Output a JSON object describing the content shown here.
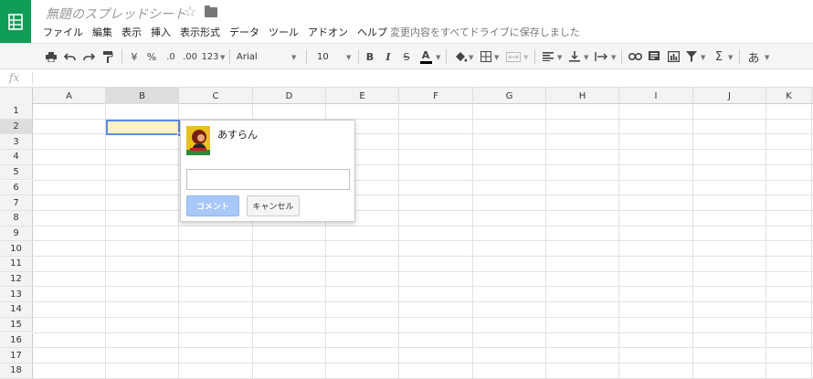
{
  "header": {
    "title": "無題のスプレッドシート",
    "save_status": "変更内容をすべてドライブに保存しました",
    "icons": [
      "sheets-logo-icon",
      "star-icon",
      "folder-icon"
    ]
  },
  "menu": [
    "ファイル",
    "編集",
    "表示",
    "挿入",
    "表示形式",
    "データ",
    "ツール",
    "アドオン",
    "ヘルプ"
  ],
  "toolbar": {
    "currency": "¥",
    "percent": "%",
    "decimal_decrease": ".0",
    "decimal_increase": ".00",
    "more_formats": "123",
    "font": "Arial",
    "font_size": "10",
    "bold": "B",
    "italic": "I",
    "strike": "S",
    "text_color": "A",
    "sum": "Σ",
    "input_tools": "あ",
    "accent_color": "#0f9d58"
  },
  "formula_bar": {
    "fx": "fx"
  },
  "grid": {
    "columns": [
      "A",
      "B",
      "C",
      "D",
      "E",
      "F",
      "G",
      "H",
      "I",
      "J",
      "K"
    ],
    "rows": [
      "1",
      "2",
      "3",
      "4",
      "5",
      "6",
      "7",
      "8",
      "9",
      "10",
      "11",
      "12",
      "13",
      "14",
      "15",
      "16",
      "17",
      "18"
    ],
    "selected_cell": "B2"
  },
  "comment": {
    "user": "あすらん",
    "input_value": "",
    "submit_label": "コメント",
    "cancel_label": "キャンセル"
  }
}
